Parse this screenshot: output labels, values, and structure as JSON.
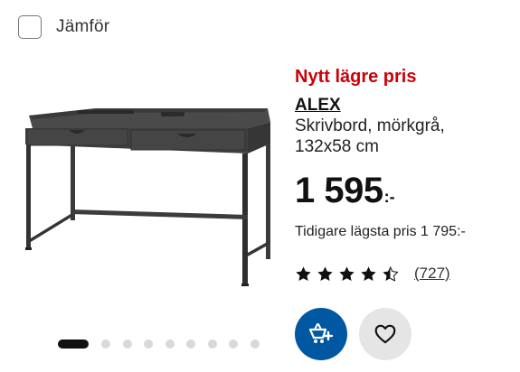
{
  "compare": {
    "label": "Jämför"
  },
  "product": {
    "badge": "Nytt lägre pris",
    "name": "ALEX",
    "description_line1": "Skrivbord, mörkgrå,",
    "description_line2": "132x58 cm",
    "price_integer": "1 595",
    "price_suffix": ":-",
    "previous_price": "Tidigare lägsta pris 1 795:-",
    "rating": 4.5,
    "rating_max": 5,
    "review_count": "(727)",
    "image_icon": "desk-icon"
  },
  "gallery": {
    "total_images": 9,
    "active_index": 0
  },
  "actions": {
    "cart_icon": "add-to-cart-icon",
    "favorite_icon": "heart-icon"
  },
  "colors": {
    "accent_blue": "#0058a3",
    "price_red": "#cc0008",
    "text": "#111111",
    "dot_inactive": "#d9d9d9"
  }
}
